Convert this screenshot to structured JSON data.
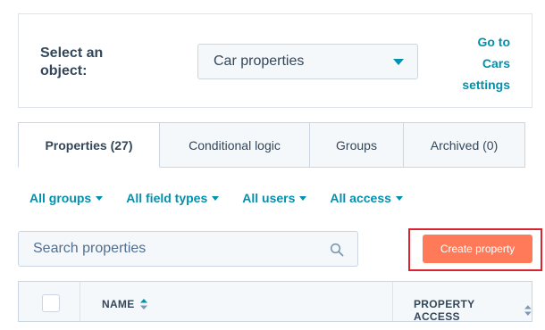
{
  "object_selector": {
    "label": "Select an object:",
    "selected_value": "Car properties",
    "settings_link": "Go to Cars settings"
  },
  "tabs": [
    {
      "label": "Properties (27)",
      "active": true
    },
    {
      "label": "Conditional logic",
      "active": false
    },
    {
      "label": "Groups",
      "active": false
    },
    {
      "label": "Archived (0)",
      "active": false
    }
  ],
  "filters": [
    {
      "label": "All groups"
    },
    {
      "label": "All field types"
    },
    {
      "label": "All users"
    },
    {
      "label": "All access"
    }
  ],
  "search": {
    "placeholder": "Search properties",
    "icon": "search-icon"
  },
  "create_button": {
    "label": "Create property"
  },
  "table": {
    "columns": [
      {
        "label": "NAME",
        "sort_icon": "sort-icon"
      },
      {
        "label": "PROPERTY ACCESS",
        "sort_icon": "sort-icon"
      }
    ]
  },
  "colors": {
    "accent_link": "#0091ae",
    "primary_button": "#ff7a59",
    "highlight": "#d9232e",
    "text": "#33475b"
  }
}
